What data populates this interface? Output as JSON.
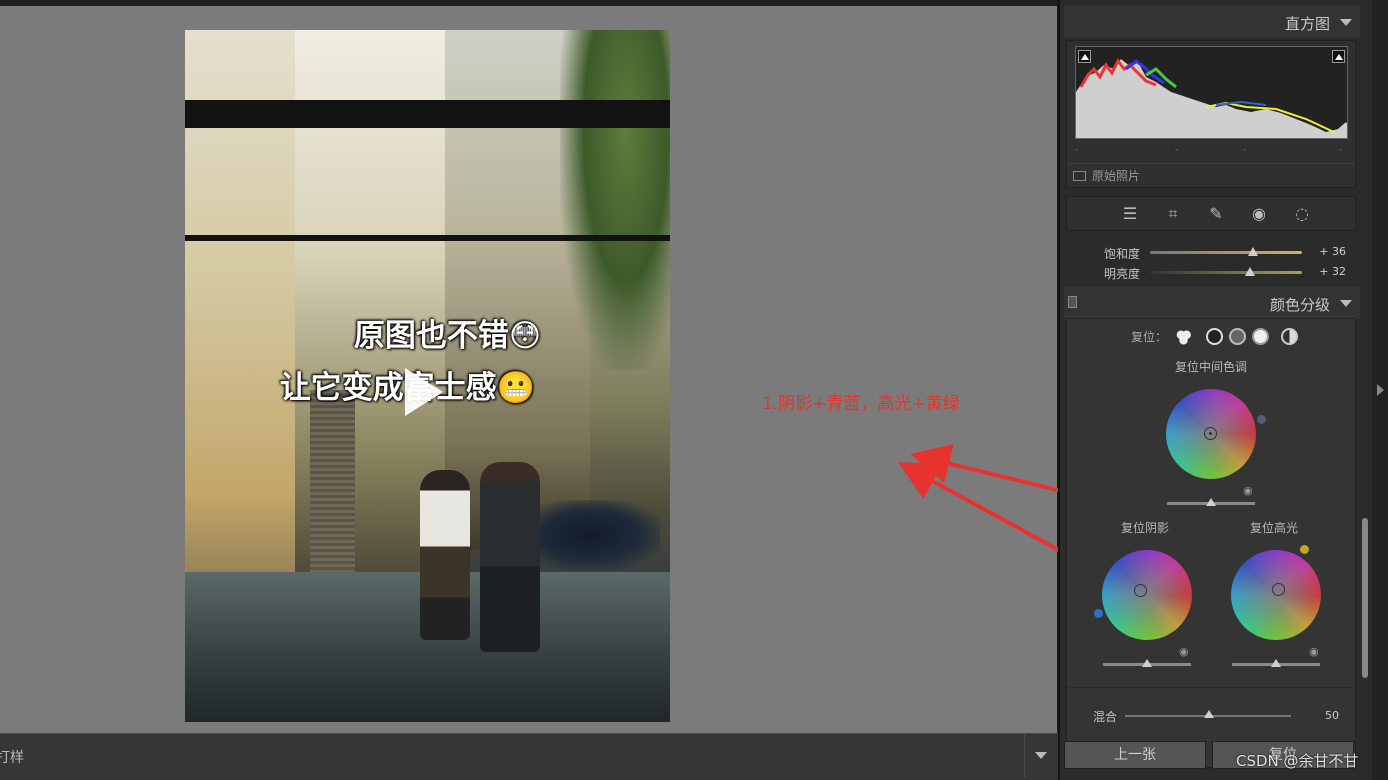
{
  "photo": {
    "caption_line1": "原图也不错😳",
    "caption_line2": "让它变成富士感😬"
  },
  "annotation": {
    "text": "1.阴影+青蓝，高光+黄绿",
    "color": "#e8322e"
  },
  "bottombar": {
    "label": "打样"
  },
  "histogram": {
    "title": "直方图",
    "original_photo_label": "原始照片"
  },
  "tools": [
    "sliders-icon",
    "crop-icon",
    "heal-icon",
    "redeye-icon",
    "radial-filter-icon"
  ],
  "sliders": [
    {
      "label": "饱和度",
      "value": "+ 36",
      "level": 0.68
    },
    {
      "label": "明亮度",
      "value": "+ 32",
      "level": 0.66
    }
  ],
  "color_grading": {
    "title": "颜色分级",
    "reset_label": "复位：",
    "midtones_label": "复位中间色调",
    "shadows_label": "复位阴影",
    "highlights_label": "复位高光",
    "blend_label": "混合",
    "blend_value": "50",
    "shadow_hue_color": "#2a74c4",
    "highlight_hue_color": "#c4a52a"
  },
  "nav": {
    "prev_label": "上一张",
    "reset_label": "复位"
  },
  "watermark": "CSDN @余甘不甘"
}
